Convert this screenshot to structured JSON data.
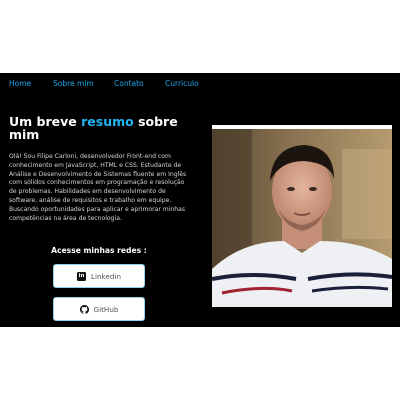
{
  "nav": {
    "items": [
      "Home",
      "Sobre mim",
      "Contato",
      "Curriculo"
    ]
  },
  "hero": {
    "title_prefix": "Um breve ",
    "title_accent": "resumo",
    "title_suffix": " sobre mim",
    "about": "Olá! Sou Filipe Carloni, desenvolvedor Front-end com conhecimento em JavaScript, HTML e CSS. Estudante de Análise e Desenvolvimento de Sistemas fluente em Inglês com sólidos conhecimentos em programação e resolução de problemas. Habilidades em desenvolvimento de software, análise de requisitos e trabalho em equipe. Buscando oportunidades para aplicar e aprimorar minhas competências na área de tecnologia."
  },
  "social": {
    "heading": "Acesse minhas redes :",
    "linkedin_icon_text": "in",
    "buttons": [
      {
        "label": "Linkedin",
        "icon": "linkedin-icon"
      },
      {
        "label": "GitHub",
        "icon": "github-icon"
      }
    ]
  },
  "colors": {
    "background": "#000000",
    "accent": "#22b4f5",
    "nav_link": "#1ea7f0"
  }
}
